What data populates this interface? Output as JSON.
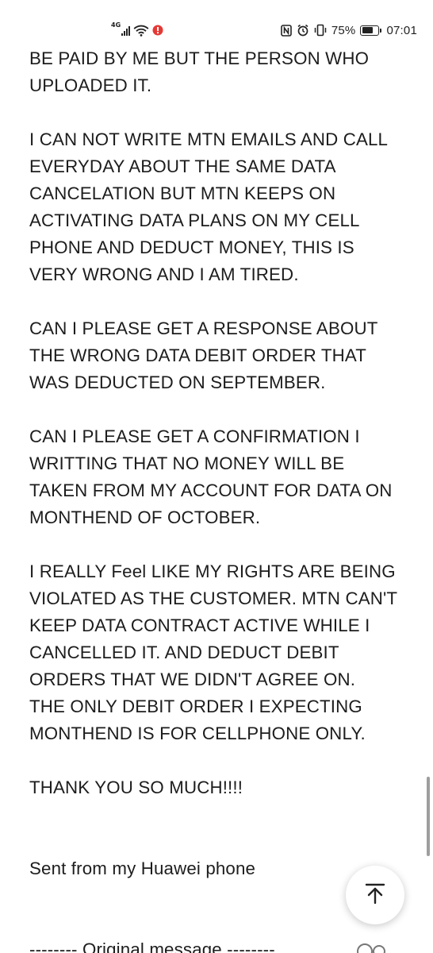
{
  "status_bar": {
    "network_type": "4G",
    "battery_percent_text": "75%",
    "battery_level": 0.75,
    "time": "07:01",
    "icons": [
      "signal-icon",
      "wifi-icon",
      "notification-icon",
      "nfc-icon",
      "alarm-icon",
      "vibrate-icon",
      "battery-icon"
    ],
    "notification_color": "#e53935"
  },
  "email": {
    "paragraphs": [
      "BE PAID BY ME BUT THE PERSON WHO\nUPLOADED IT.",
      "I CAN NOT WRITE MTN EMAILS AND CALL\nEVERYDAY ABOUT THE SAME DATA\nCANCELATION BUT MTN KEEPS ON\nACTIVATING DATA PLANS ON MY CELL\nPHONE AND DEDUCT MONEY, THIS IS\nVERY WRONG AND I AM TIRED.",
      "CAN I PLEASE GET A RESPONSE ABOUT\nTHE WRONG DATA DEBIT ORDER THAT\nWAS DEDUCTED ON SEPTEMBER.",
      "CAN I PLEASE GET A CONFIRMATION I\nWRITTING THAT NO MONEY WILL BE\nTAKEN FROM MY ACCOUNT FOR DATA ON\nMONTHEND OF OCTOBER.",
      "I REALLY Feel LIKE  MY RIGHTS ARE BEING\nVIOLATED AS THE CUSTOMER. MTN CAN'T\nKEEP DATA CONTRACT ACTIVE WHILE I\nCANCELLED IT. AND DEDUCT DEBIT\nORDERS THAT WE DIDN'T AGREE ON.\nTHE ONLY DEBIT ORDER I EXPECTING\nMONTHEND IS FOR CELLPHONE ONLY.",
      "THANK YOU SO MUCH!!!!"
    ],
    "signature": "Sent from my Huawei phone",
    "original_message_divider": "-------- Original message --------"
  },
  "controls": {
    "scroll_to_top_icon": "arrow-up-to-top-icon"
  }
}
